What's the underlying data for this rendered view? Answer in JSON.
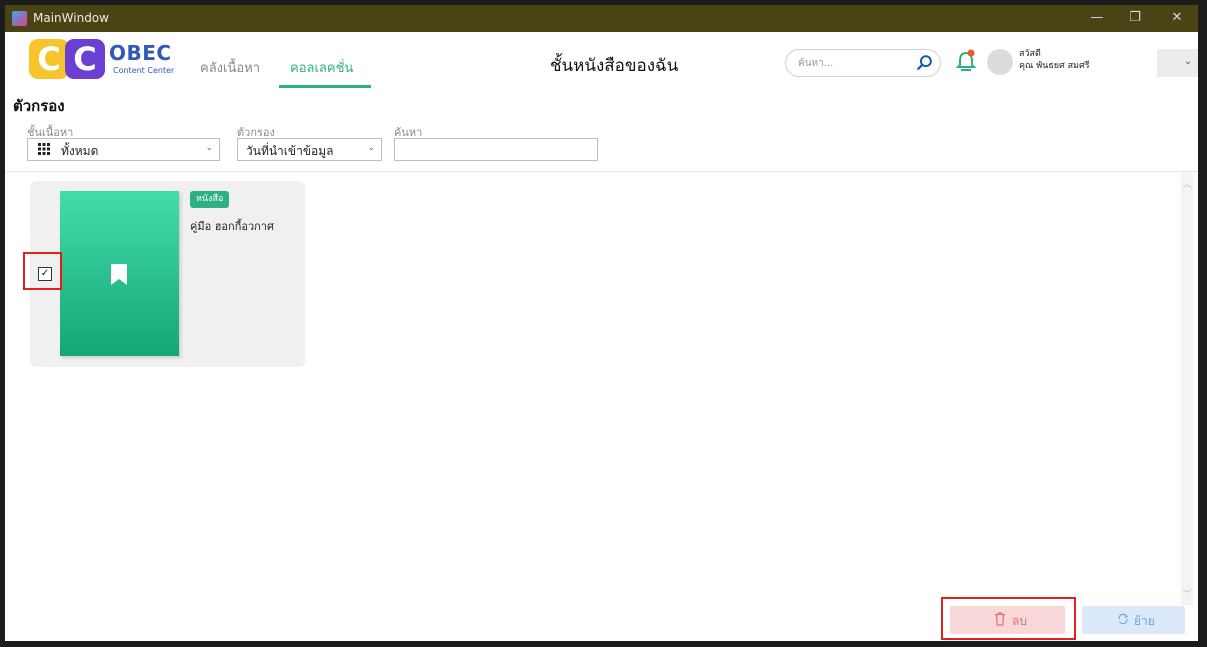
{
  "window": {
    "title": "MainWindow",
    "controls": {
      "minimize": "—",
      "maximize": "❐",
      "close": "✕"
    }
  },
  "logo": {
    "c1": "C",
    "c2": "C",
    "name": "OBEC",
    "subtitle": "Content Center"
  },
  "nav": {
    "tabs": [
      {
        "label": "คลังเนื้อหา",
        "active": false
      },
      {
        "label": "คอลเลคชั่น",
        "active": true
      }
    ]
  },
  "header": {
    "title": "ชั้นหนังสือของฉัน",
    "search_placeholder": "ค้นหา...",
    "greeting": "สวัสดี",
    "user_name": "คุณ พันธยศ สมศรี",
    "menu_chevron": "⌄"
  },
  "filters": {
    "title": "ตัวกรอง",
    "category": {
      "label": "ชั้นเนื้อหา",
      "value": "ทั้งหมด"
    },
    "sort": {
      "label": "ตัวกรอง",
      "value": "วันที่นำเข้าข้อมูล"
    },
    "search": {
      "label": "ค้นหา",
      "value": ""
    },
    "chevron": "⌄"
  },
  "items": [
    {
      "badge": "หนังสือ",
      "title": "คู่มือ ฮอกกี้อวกาศ",
      "checked": true,
      "check_mark": "✓"
    }
  ],
  "actions": {
    "delete_label": "ลบ",
    "move_label": "ย้าย"
  },
  "colors": {
    "accent": "#2fb083",
    "titlebar": "#4a4415",
    "delete_bg": "#f8d7d8",
    "move_bg": "#dbe9fb",
    "highlight": "#e0211f"
  }
}
